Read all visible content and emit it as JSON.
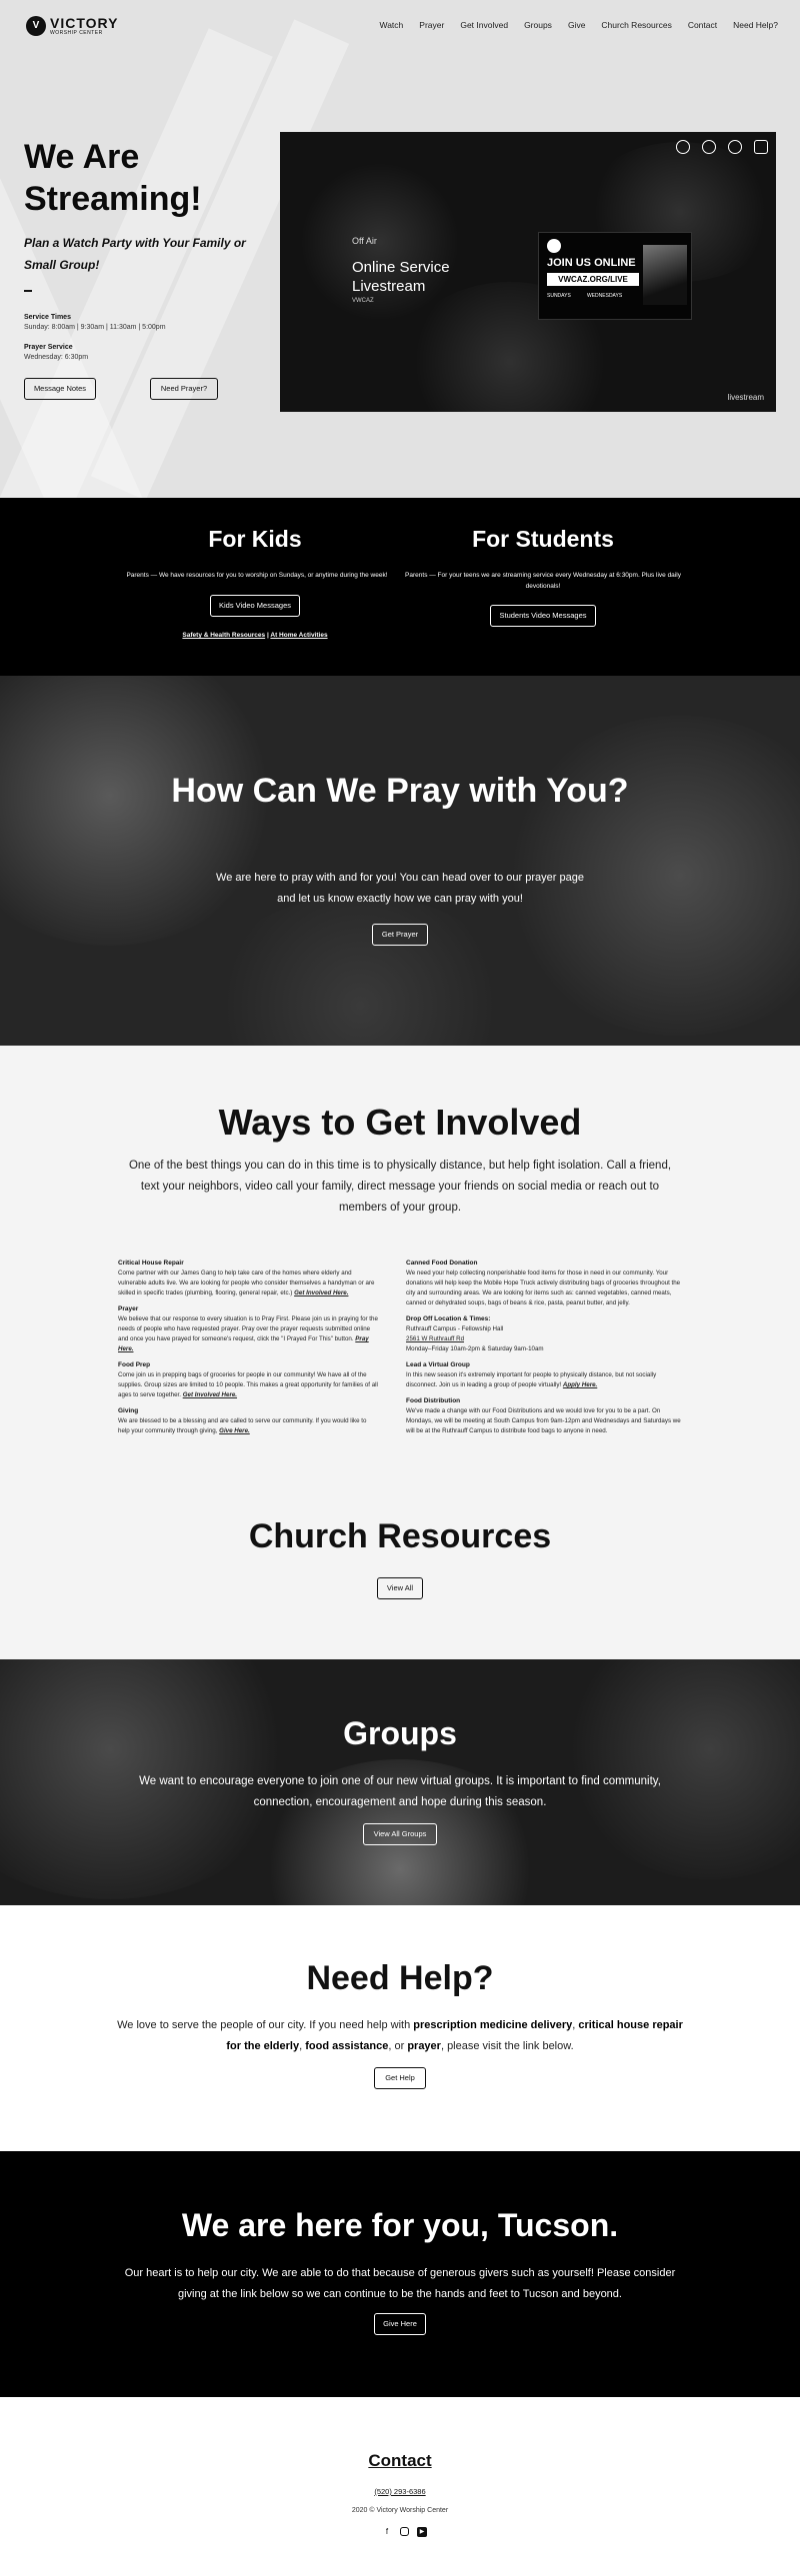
{
  "header": {
    "logo_mark": "V",
    "logo_name": "VICTORY",
    "logo_sub": "WORSHIP CENTER",
    "nav": [
      "Watch",
      "Prayer",
      "Get Involved",
      "Groups",
      "Give",
      "Church Resources",
      "Contact",
      "Need Help?"
    ]
  },
  "hero": {
    "title": "We Are Streaming!",
    "subtitle": "Plan a Watch Party with Your Family or Small Group!",
    "dash": "–",
    "service_times_label": "Service Times",
    "service_times": "Sunday: 8:00am | 9:30am | 11:30am | 5:00pm",
    "prayer_label": "Prayer Service",
    "prayer_time": "Wednesday: 6:30pm",
    "btn_notes": "Message Notes",
    "btn_prayer": "Need Prayer?"
  },
  "video": {
    "status": "Off Air",
    "title": "Online Service Livestream",
    "channel": "VWCAZ",
    "card_heading": "JOIN US ONLINE",
    "card_url": "VWCAZ.ORG/LIVE",
    "card_day1": "SUNDAYS",
    "card_day2": "WEDNESDAYS",
    "watermark": "livestream",
    "icons": [
      "heart-icon",
      "share-icon",
      "info-icon",
      "lock-icon"
    ]
  },
  "kids": {
    "title": "For Kids",
    "text": "Parents — We have resources for you to worship on Sundays, or anytime during the week!",
    "button": "Kids Video Messages",
    "link1": "Safety & Health Resources",
    "sep": "|",
    "link2": "At Home Activities"
  },
  "students": {
    "title": "For Students",
    "text": "Parents — For your teens we are streaming service every Wednesday at 6:30pm. Plus live daily devotionals!",
    "button": "Students Video Messages"
  },
  "pray": {
    "title": "How Can We Pray with You?",
    "text": "We are here to pray with and for you! You can head over to our prayer page and let us know exactly how we can pray with you!",
    "button": "Get Prayer"
  },
  "involved": {
    "title": "Ways to Get Involved",
    "text": "One of the best things you can do in this time is to physically distance, but help fight isolation. Call a friend, text your neighbors, video call your family, direct message your friends on social media or reach out to members of your group.",
    "left": [
      {
        "h": "Critical House Repair",
        "p": "Come partner with our James Gang to help take care of the homes where elderly and vulnerable adults live. We are looking for people who consider themselves a handyman or are skilled in specific trades (plumbing, flooring, general repair, etc.)",
        "link": "Get Involved Here."
      },
      {
        "h": "Prayer",
        "p": "We believe that our response to every situation is to Pray First. Please join us in praying for the needs of people who have requested prayer. Pray over the prayer requests submitted online and once you have prayed for someone's request, click the \"I Prayed For This\" button.",
        "link": "Pray Here."
      },
      {
        "h": "Food Prep",
        "p": "Come join us in prepping bags of groceries for people in our community! We have all of the supplies. Group sizes are limited to 10 people. This makes a great opportunity for families of all ages to serve together.",
        "link": "Get Involved Here."
      },
      {
        "h": "Giving",
        "p": "We are blessed to be a blessing and are called to serve our community. If you would like to help your community through giving,",
        "link": "Give Here."
      }
    ],
    "right": [
      {
        "h": "Canned Food Donation",
        "p": "We need your help collecting nonperishable food items for those in need in our community. Your donations will help keep the Mobile Hope Truck actively distributing bags of groceries throughout the city and surrounding areas. We are looking for items such as: canned vegetables, canned meats, canned or dehydrated soups, bags of beans & rice, pasta, peanut butter, and jelly.",
        "link": ""
      },
      {
        "h": "Drop Off Location & Times:",
        "p": "Ruthrauff Campus - Fellowship Hall",
        "p2": "2561 W Ruthrauff Rd",
        "p3": "Monday–Friday 10am-2pm & Saturday 9am-10am",
        "link": ""
      },
      {
        "h": "Lead a Virtual Group",
        "p": "In this new season it's extremely important for people to physically distance, but not socially disconnect. Join us in leading a group of people virtually!",
        "link": "Apply Here."
      },
      {
        "h": "Food Distribution",
        "p": "We've made a change with our Food Distributions and we would love for you to be a part. On Mondays, we will be meeting at South Campus from 9am-12pm and Wednesdays and Saturdays we will be at the Ruthrauff Campus to distribute food bags to anyone in need.",
        "link": ""
      }
    ]
  },
  "resources": {
    "title": "Church Resources",
    "button": "View All"
  },
  "groups": {
    "title": "Groups",
    "text": "We want to encourage everyone to join one of our new virtual groups. It is important to find community, connection, encouragement and hope during this season.",
    "button": "View All Groups"
  },
  "help": {
    "title": "Need Help?",
    "t1": "We love to serve the people of our city.  If you need help with ",
    "b1": "prescription medicine delivery",
    "t2": ", ",
    "b2": "critical house repair for the elderly",
    "t3": ", ",
    "b3": "food assistance",
    "t4": ", or ",
    "b4": "prayer",
    "t5": ", please visit the link below.",
    "button": "Get Help"
  },
  "tucson": {
    "title": "We are here for you, Tucson.",
    "text": "Our heart is to help our city. We are able to do that because of generous givers such as yourself! Please consider giving at the link below so we can continue to be the hands and feet to Tucson and beyond.",
    "button": "Give Here"
  },
  "footer": {
    "title": "Contact",
    "phone": "(520) 293-6386",
    "copyright": "2020 © Victory Worship Center",
    "social": [
      "facebook-icon",
      "instagram-icon",
      "youtube-icon"
    ]
  }
}
